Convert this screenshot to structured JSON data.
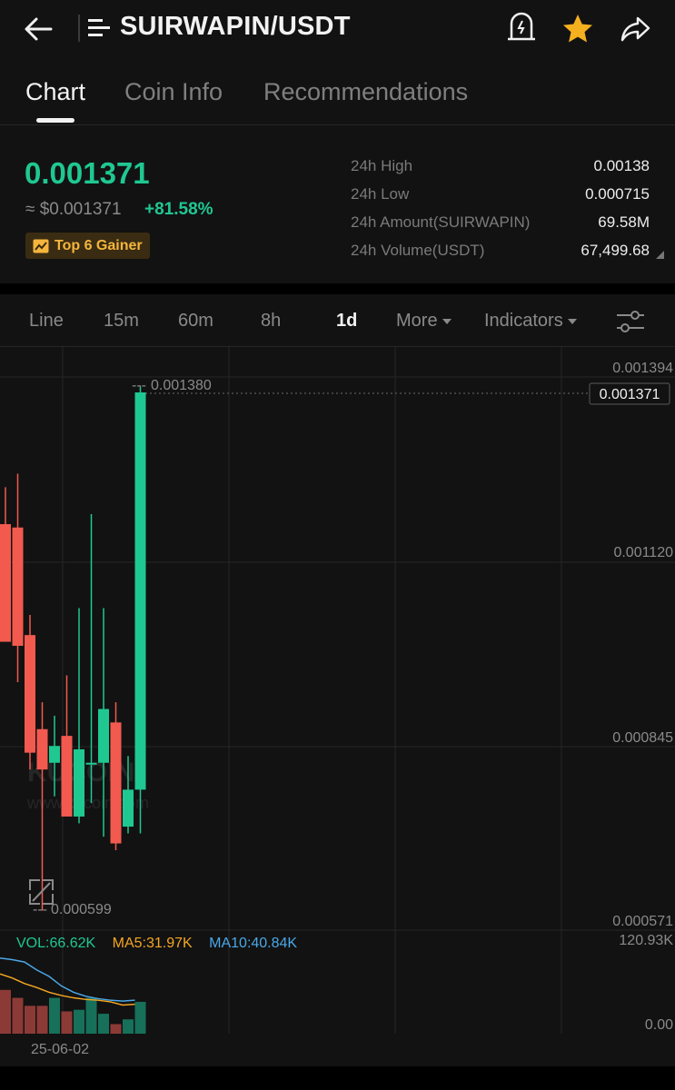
{
  "header": {
    "pair": "SUIRWAPIN/USDT",
    "icons": [
      "back-arrow-icon",
      "menu-icon",
      "price-alert-icon",
      "star-icon",
      "share-icon"
    ],
    "star_color": "#f5b01f"
  },
  "tabs": [
    {
      "label": "Chart",
      "active": true
    },
    {
      "label": "Coin Info",
      "active": false
    },
    {
      "label": "Recommendations",
      "active": false
    }
  ],
  "price": {
    "last": "0.001371",
    "usd": "≈ $0.001371",
    "change": "+81.58%",
    "badge": "Top 6 Gainer",
    "up_color": "#1fc891",
    "down_color": "#f25a4f"
  },
  "stats": [
    {
      "label": "24h High",
      "value": "0.00138"
    },
    {
      "label": "24h Low",
      "value": "0.000715"
    },
    {
      "label": "24h Amount(SUIRWAPIN)",
      "value": "69.58M"
    },
    {
      "label": "24h Volume(USDT)",
      "value": "67,499.68"
    }
  ],
  "toolbar": {
    "timeframes": [
      {
        "label": "Line",
        "active": false
      },
      {
        "label": "15m",
        "active": false
      },
      {
        "label": "60m",
        "active": false
      },
      {
        "label": "8h",
        "active": false
      },
      {
        "label": "1d",
        "active": true
      }
    ],
    "more": "More",
    "indicators": "Indicators"
  },
  "chart": {
    "price_ticks": [
      "0.001394",
      "0.001120",
      "0.000845",
      "0.000571"
    ],
    "current_price_tag": "0.001371",
    "high_marker": "0.001380",
    "low_marker": "0.000599",
    "watermark": "KUCOIN",
    "watermark_url": "www.kucoin.com",
    "volume_ticks": [
      "120.93K",
      "0.00"
    ],
    "date_label": "25-06-02",
    "vol_legend": {
      "vol": "VOL:66.62K",
      "ma5": "MA5:31.97K",
      "ma10": "MA10:40.84K"
    },
    "colors": {
      "ma5": "#f5a623",
      "ma10": "#4aa8e8"
    }
  },
  "chart_data": {
    "type": "candlestick",
    "ylim": [
      0.000571,
      0.001394
    ],
    "candles": [
      {
        "open": 0.001175,
        "high": 0.00123,
        "low": 0.00101,
        "close": 0.001
      },
      {
        "open": 0.00117,
        "high": 0.00125,
        "low": 0.00094,
        "close": 0.000994
      },
      {
        "open": 0.00101,
        "high": 0.00104,
        "low": 0.00081,
        "close": 0.000835
      },
      {
        "open": 0.00087,
        "high": 0.00091,
        "low": 0.0006,
        "close": 0.00081
      },
      {
        "open": 0.00082,
        "high": 0.00089,
        "low": 0.00077,
        "close": 0.000845
      },
      {
        "open": 0.00086,
        "high": 0.00095,
        "low": 0.00076,
        "close": 0.00074
      },
      {
        "open": 0.00074,
        "high": 0.00105,
        "low": 0.00073,
        "close": 0.00084
      },
      {
        "open": 0.00082,
        "high": 0.00119,
        "low": 0.00076,
        "close": 0.00082
      },
      {
        "open": 0.00082,
        "high": 0.00105,
        "low": 0.00071,
        "close": 0.0009
      },
      {
        "open": 0.00088,
        "high": 0.00091,
        "low": 0.00069,
        "close": 0.0007
      },
      {
        "open": 0.000725,
        "high": 0.00083,
        "low": 0.000715,
        "close": 0.00078
      },
      {
        "open": 0.00078,
        "high": 0.00138,
        "low": 0.000715,
        "close": 0.001371
      }
    ],
    "volume": [
      55,
      45,
      35,
      35,
      45,
      28,
      30,
      45,
      25,
      12,
      18,
      40
    ],
    "ma5": [
      75,
      70,
      63,
      58,
      52,
      48,
      45,
      43,
      42,
      40,
      36,
      37
    ],
    "ma10": [
      95,
      93,
      90,
      80,
      72,
      60,
      52,
      47,
      44,
      42,
      41,
      42
    ],
    "vol_max": 120.93
  }
}
